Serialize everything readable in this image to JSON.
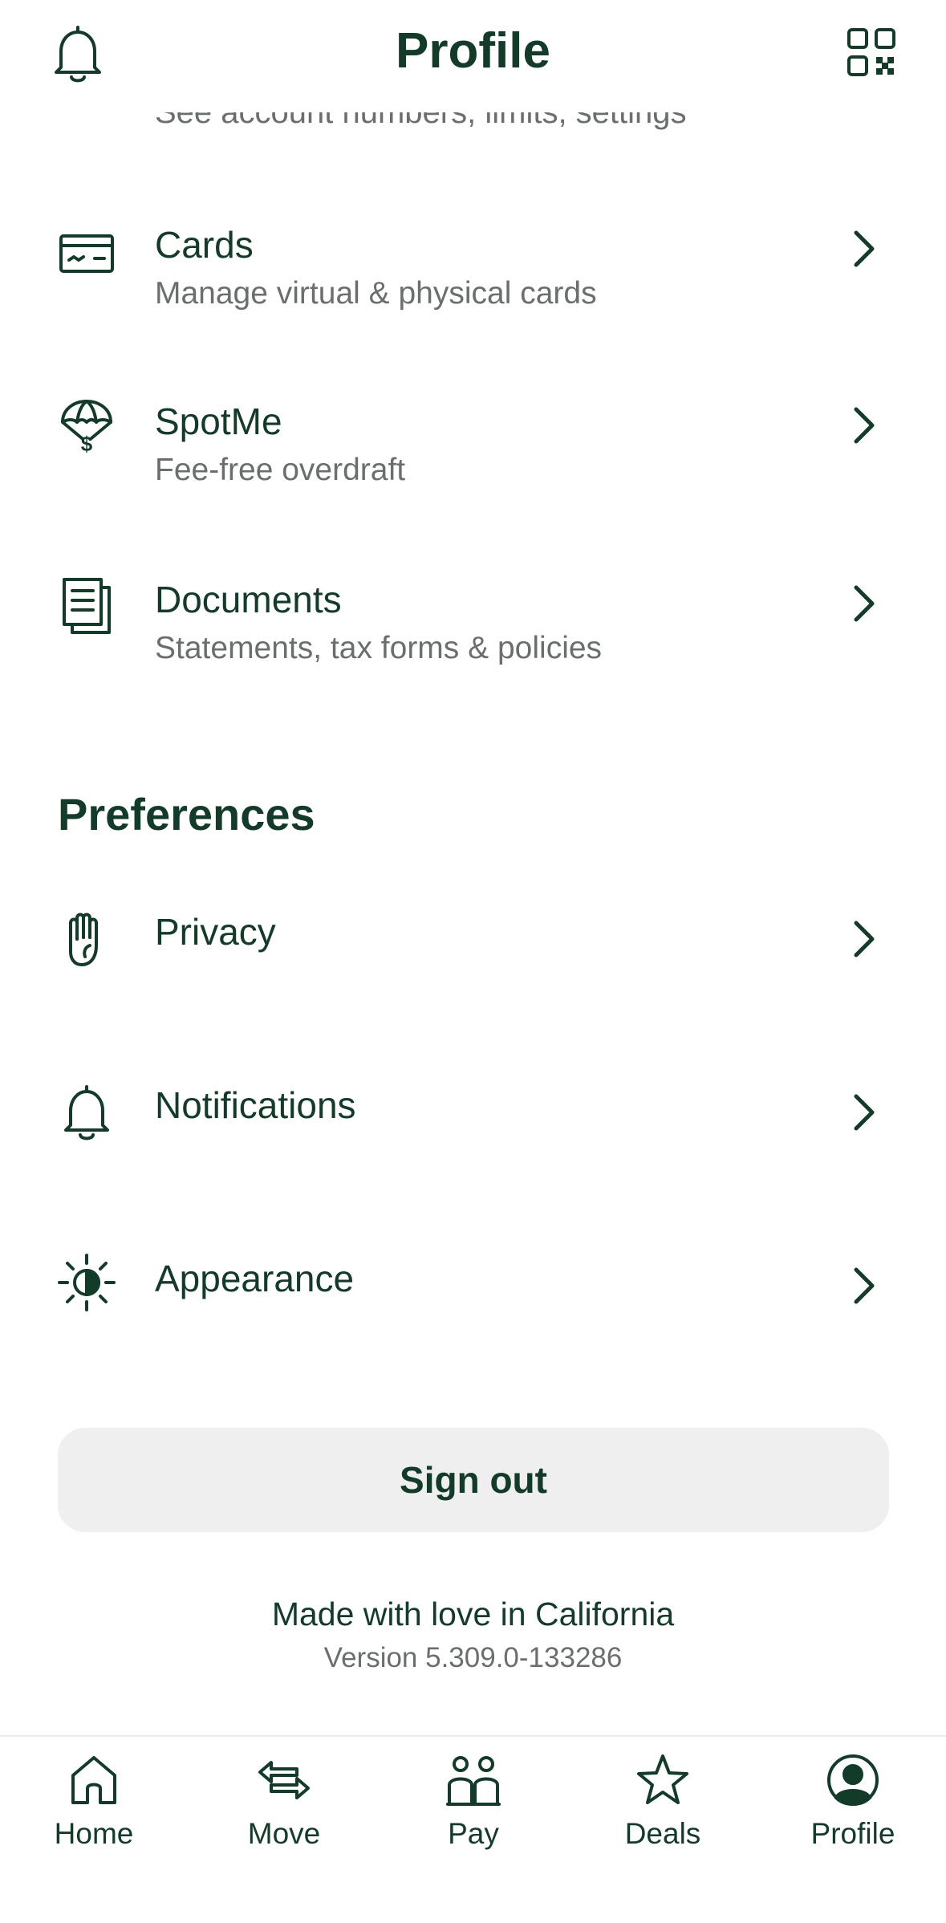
{
  "header": {
    "title": "Profile",
    "left_icon": "bell-icon",
    "right_icon": "qr-code-icon"
  },
  "partial_item": {
    "subtitle": "See account numbers, limits, settings"
  },
  "items": [
    {
      "label": "Cards",
      "subtitle": "Manage virtual & physical cards",
      "icon": "card-icon"
    },
    {
      "label": "SpotMe",
      "subtitle": "Fee-free overdraft",
      "icon": "parachute-dollar-icon"
    },
    {
      "label": "Documents",
      "subtitle": "Statements, tax forms & policies",
      "icon": "documents-icon"
    }
  ],
  "preferences": {
    "title": "Preferences",
    "items": [
      {
        "label": "Privacy",
        "icon": "hand-icon"
      },
      {
        "label": "Notifications",
        "icon": "bell-icon"
      },
      {
        "label": "Appearance",
        "icon": "brightness-icon"
      }
    ]
  },
  "sign_out": "Sign out",
  "footer": {
    "love": "Made with love in California",
    "version": "Version 5.309.0-133286"
  },
  "tabs": [
    {
      "label": "Home",
      "icon": "home-icon"
    },
    {
      "label": "Move",
      "icon": "move-arrows-icon"
    },
    {
      "label": "Pay",
      "icon": "pay-people-icon"
    },
    {
      "label": "Deals",
      "icon": "star-icon"
    },
    {
      "label": "Profile",
      "icon": "profile-icon",
      "active": true
    }
  ],
  "colors": {
    "primary": "#133b2a",
    "secondary_text": "#6a6f6c",
    "button_bg": "#efefef"
  }
}
